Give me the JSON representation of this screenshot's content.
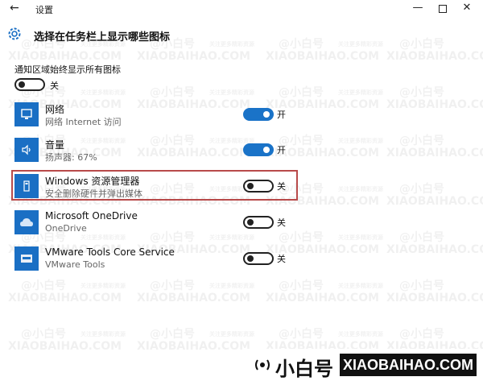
{
  "window": {
    "back_glyph": "←",
    "title": "设置",
    "minimize_glyph": "—",
    "close_glyph": "✕"
  },
  "header": {
    "page_title": "选择在任务栏上显示哪些图标",
    "icon": "gear-icon"
  },
  "always_show": {
    "label": "通知区域始终显示所有图标",
    "state": "关",
    "on": false
  },
  "apps": [
    {
      "name": "网络",
      "desc": "网络 Internet 访问",
      "state": "开",
      "on": true,
      "icon": "network-monitor-icon"
    },
    {
      "name": "音量",
      "desc": "扬声器: 67%",
      "state": "开",
      "on": true,
      "icon": "speaker-icon"
    },
    {
      "name": "Windows 资源管理器",
      "desc": "安全删除硬件并弹出媒体",
      "state": "关",
      "on": false,
      "icon": "usb-drive-icon"
    },
    {
      "name": "Microsoft OneDrive",
      "desc": "OneDrive",
      "state": "关",
      "on": false,
      "icon": "cloud-icon"
    },
    {
      "name": "VMware Tools Core Service",
      "desc": "VMware Tools",
      "state": "关",
      "on": false,
      "icon": "vmware-icon"
    }
  ],
  "watermark": {
    "handle": "@小白号",
    "domain": "XIAOBAIHAO.COM",
    "small": "关注更多精彩资源",
    "brand_cn": "小白号",
    "brand_en": "XIAOBAIHAO.COM"
  },
  "colors": {
    "accent": "#1a73c8",
    "tile": "#1a6fc4",
    "highlight_border": "#b84a4a"
  }
}
